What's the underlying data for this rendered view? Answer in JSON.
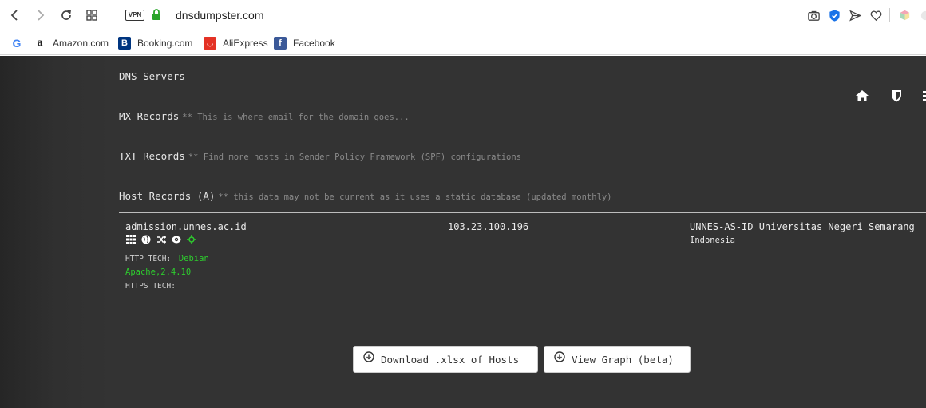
{
  "browser": {
    "url": "dnsdumpster.com",
    "vpn_label": "VPN",
    "bookmarks": [
      {
        "label": "",
        "icon": "google-icon"
      },
      {
        "label": "Amazon.com",
        "icon": "amazon-icon"
      },
      {
        "label": "Booking.com",
        "icon": "booking-icon"
      },
      {
        "label": "AliExpress",
        "icon": "aliexpress-icon"
      },
      {
        "label": "Facebook",
        "icon": "facebook-icon"
      }
    ]
  },
  "sections": {
    "dns_servers": {
      "title": "DNS Servers"
    },
    "mx_records": {
      "title": "MX Records",
      "note": "** This is where email for the domain goes..."
    },
    "txt_records": {
      "title": "TXT Records",
      "note": "** Find more hosts in Sender Policy Framework (SPF) configurations"
    },
    "host_records": {
      "title": "Host Records (A)",
      "note": "** this data may not be current as it uses a static database (updated monthly)"
    }
  },
  "host_row": {
    "hostname": "admission.unnes.ac.id",
    "http_tech_label": "HTTP TECH:",
    "http_tech_value_1": "Debian",
    "http_tech_value_2": "Apache,2.4.10",
    "https_tech_label": "HTTPS TECH:",
    "ip": "103.23.100.196",
    "asn": "UNNES-AS-ID Universitas Negeri Semarang",
    "country": "Indonesia"
  },
  "buttons": {
    "download": "Download .xlsx of Hosts",
    "graph": "View Graph (beta)"
  },
  "colors": {
    "page_bg": "#333333",
    "accent_green": "#2ecc2e",
    "lock_green": "#2aa52a",
    "shield_blue": "#1a73e8"
  }
}
